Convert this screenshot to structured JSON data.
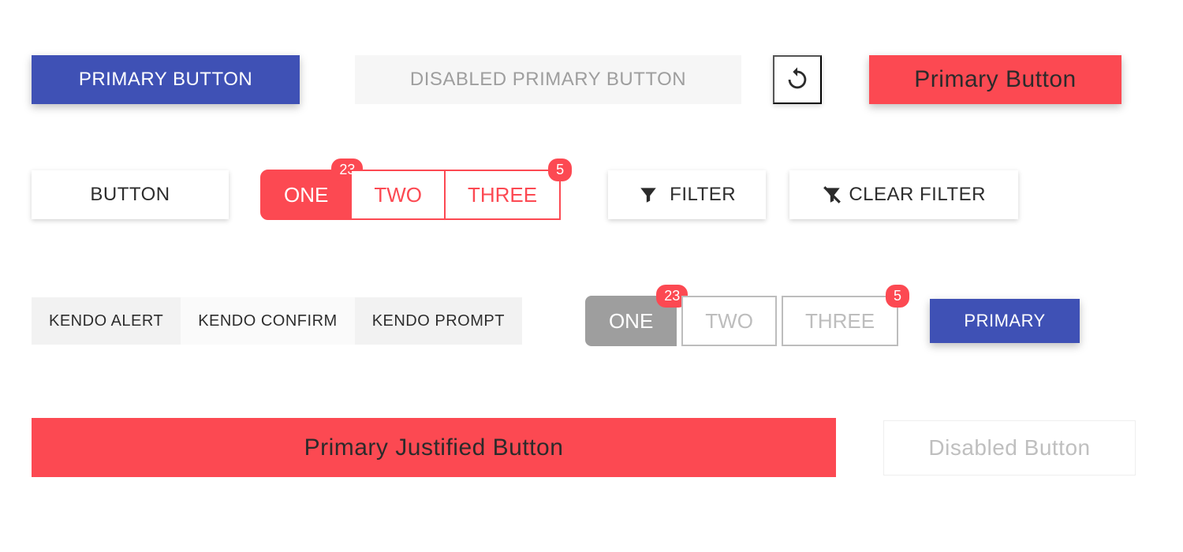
{
  "colors": {
    "blue": "#3f51b5",
    "red": "#fc4952",
    "grey": "#9e9e9e"
  },
  "row1": {
    "primary_blue": "PRIMARY BUTTON",
    "disabled_primary": "DISABLED PRIMARY BUTTON",
    "refresh_icon": "refresh",
    "primary_red": "Primary Button"
  },
  "row2": {
    "default_button": "BUTTON",
    "segmented_red": {
      "items": [
        {
          "label": "ONE",
          "badge": "23",
          "active": true
        },
        {
          "label": "TWO",
          "badge": null,
          "active": false
        },
        {
          "label": "THREE",
          "badge": "5",
          "active": false
        }
      ]
    },
    "filter": {
      "label": "FILTER",
      "icon": "funnel"
    },
    "clear_filter": {
      "label": "CLEAR FILTER",
      "icon": "funnel-clear"
    }
  },
  "row3": {
    "dialogs": {
      "alert": "KENDO ALERT",
      "confirm": "KENDO CONFIRM",
      "prompt": "KENDO PROMPT"
    },
    "segmented_grey": {
      "items": [
        {
          "label": "ONE",
          "badge": "23",
          "active": true
        },
        {
          "label": "TWO",
          "badge": null,
          "active": false
        },
        {
          "label": "THREE",
          "badge": "5",
          "active": false
        }
      ]
    },
    "primary_small": "PRIMARY"
  },
  "row4": {
    "justified": "Primary Justified Button",
    "disabled": "Disabled Button"
  }
}
